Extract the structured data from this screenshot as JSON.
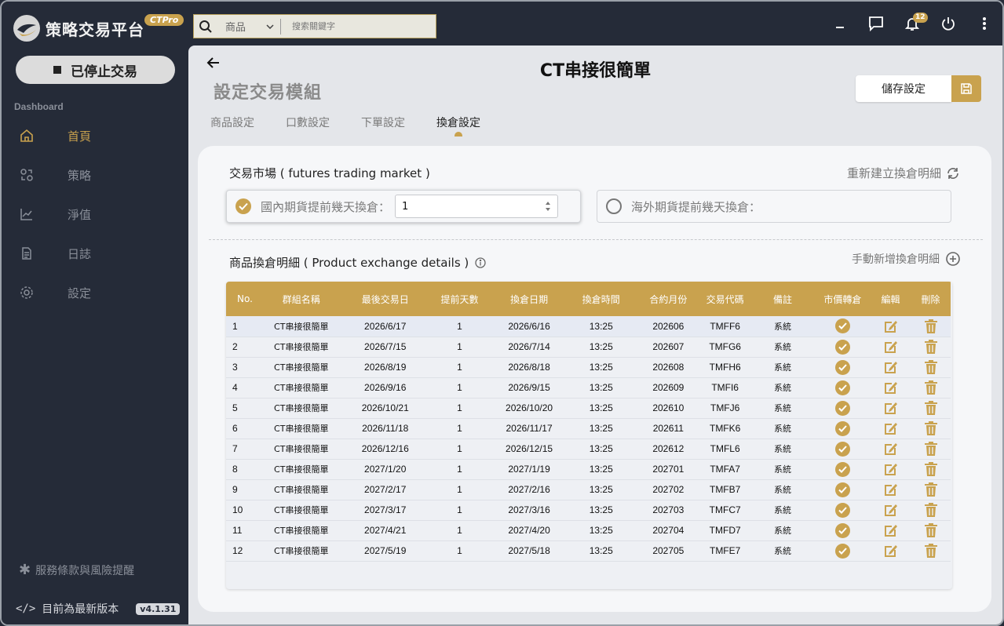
{
  "app": {
    "brand_name": "策略交易平台",
    "brand_badge": "CTPro",
    "stop_label": "已停止交易",
    "section_label": "Dashboard",
    "terms_label": "服務條款與風險提醒",
    "version_label": "目前為最新版本",
    "version": "v4.1.31"
  },
  "nav": [
    {
      "label": "首頁",
      "icon": "home-icon"
    },
    {
      "label": "策略",
      "icon": "strategy-icon"
    },
    {
      "label": "淨值",
      "icon": "chart-icon"
    },
    {
      "label": "日誌",
      "icon": "document-icon"
    },
    {
      "label": "設定",
      "icon": "gear-icon"
    }
  ],
  "topbar": {
    "search_category": "商品",
    "search_placeholder": "搜索關鍵字",
    "notification_count": "12"
  },
  "page": {
    "title": "CT串接很簡單",
    "subtitle": "設定交易模組",
    "save_label": "儲存設定",
    "tabs": [
      "商品設定",
      "口數設定",
      "下單設定",
      "換倉設定"
    ],
    "active_tab": 3
  },
  "market": {
    "label": "交易市場 ( futures trading market )",
    "rebuild_label": "重新建立換倉明細",
    "domestic_label": "國內期貨提前幾天換倉：",
    "domestic_value": "1",
    "foreign_label": "海外期貨提前幾天換倉："
  },
  "details": {
    "label": "商品換倉明細 ( Product exchange details )",
    "add_label": "手動新增換倉明細"
  },
  "table": {
    "headers": [
      "No.",
      "群組名稱",
      "最後交易日",
      "提前天數",
      "換倉日期",
      "換倉時間",
      "合約月份",
      "交易代碼",
      "備註",
      "市價轉倉",
      "編輯",
      "刪除"
    ],
    "rows": [
      [
        "1",
        "CT串接很簡單",
        "2026/6/17",
        "1",
        "2026/6/16",
        "13:25",
        "202606",
        "TMFF6",
        "系統"
      ],
      [
        "2",
        "CT串接很簡單",
        "2026/7/15",
        "1",
        "2026/7/14",
        "13:25",
        "202607",
        "TMFG6",
        "系統"
      ],
      [
        "3",
        "CT串接很簡單",
        "2026/8/19",
        "1",
        "2026/8/18",
        "13:25",
        "202608",
        "TMFH6",
        "系統"
      ],
      [
        "4",
        "CT串接很簡單",
        "2026/9/16",
        "1",
        "2026/9/15",
        "13:25",
        "202609",
        "TMFI6",
        "系統"
      ],
      [
        "5",
        "CT串接很簡單",
        "2026/10/21",
        "1",
        "2026/10/20",
        "13:25",
        "202610",
        "TMFJ6",
        "系統"
      ],
      [
        "6",
        "CT串接很簡單",
        "2026/11/18",
        "1",
        "2026/11/17",
        "13:25",
        "202611",
        "TMFK6",
        "系統"
      ],
      [
        "7",
        "CT串接很簡單",
        "2026/12/16",
        "1",
        "2026/12/15",
        "13:25",
        "202612",
        "TMFL6",
        "系統"
      ],
      [
        "8",
        "CT串接很簡單",
        "2027/1/20",
        "1",
        "2027/1/19",
        "13:25",
        "202701",
        "TMFA7",
        "系統"
      ],
      [
        "9",
        "CT串接很簡單",
        "2027/2/17",
        "1",
        "2027/2/16",
        "13:25",
        "202702",
        "TMFB7",
        "系統"
      ],
      [
        "10",
        "CT串接很簡單",
        "2027/3/17",
        "1",
        "2027/3/16",
        "13:25",
        "202703",
        "TMFC7",
        "系統"
      ],
      [
        "11",
        "CT串接很簡單",
        "2027/4/21",
        "1",
        "2027/4/20",
        "13:25",
        "202704",
        "TMFD7",
        "系統"
      ],
      [
        "12",
        "CT串接很簡單",
        "2027/5/19",
        "1",
        "2027/5/18",
        "13:25",
        "202705",
        "TMFE7",
        "系統"
      ]
    ]
  },
  "colors": {
    "accent": "#c9a24e",
    "sidebar_bg": "#252b38",
    "content_bg": "#e4e6ea",
    "card_bg": "#f6f7f9"
  }
}
